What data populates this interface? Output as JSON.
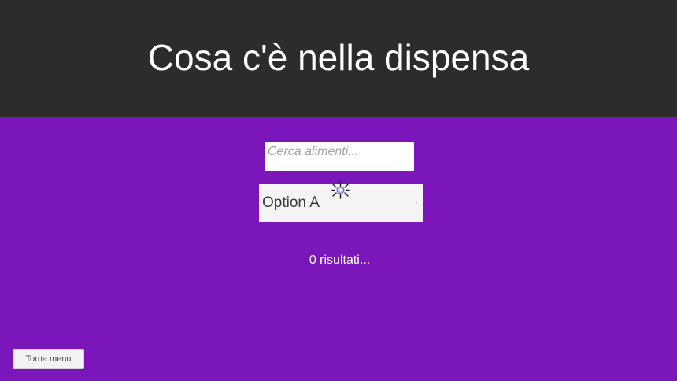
{
  "header": {
    "title": "Cosa c'è nella dispensa"
  },
  "search": {
    "placeholder": "Cerca alimenti...",
    "value": ""
  },
  "filter": {
    "selected": "Option A",
    "chevron_icon": "chevron-down-icon"
  },
  "loader": {
    "icon": "loading-spinner-icon"
  },
  "results": {
    "text": "0 risultati..."
  },
  "footer": {
    "back_label": "Torna menu"
  },
  "colors": {
    "header_bg": "#2c2c2c",
    "body_bg": "#7b16ba",
    "text_light": "#ffffff"
  }
}
